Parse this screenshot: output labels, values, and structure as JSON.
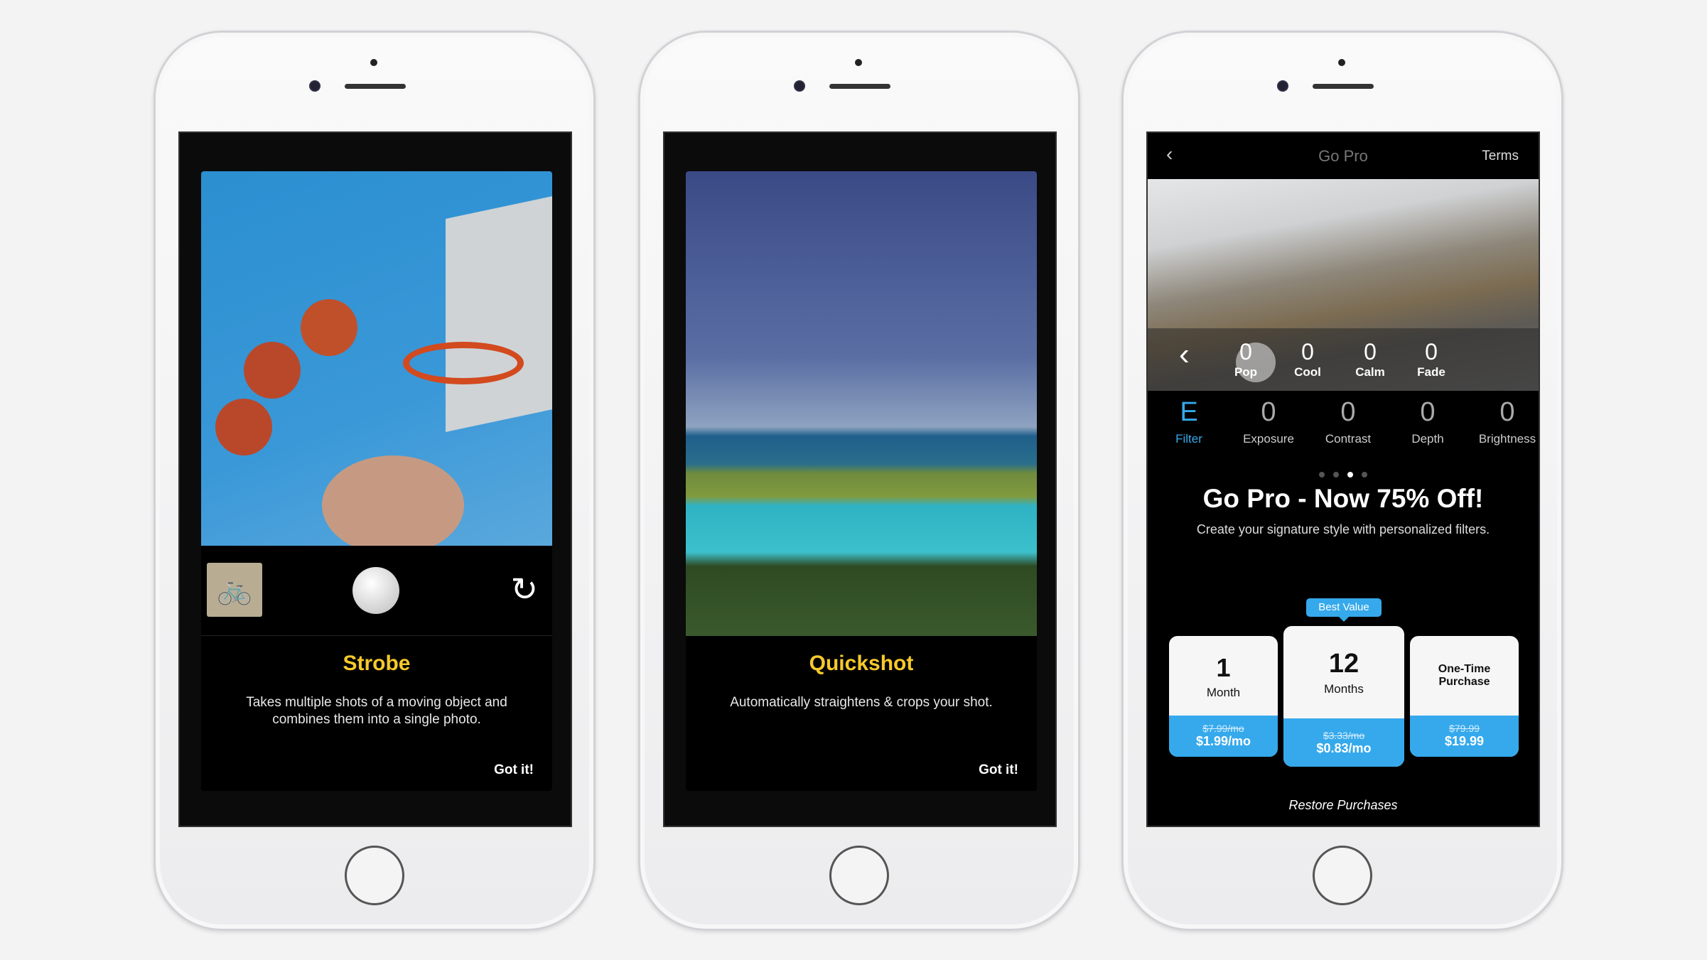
{
  "phones": [
    {
      "feature_title": "Strobe",
      "description": "Takes multiple shots of a moving object and combines them into a single photo.",
      "dismiss_label": "Got it!"
    },
    {
      "feature_title": "Quickshot",
      "description": "Automatically straightens & crops your shot.",
      "dismiss_label": "Got it!"
    }
  ],
  "gopro": {
    "header": {
      "title": "Go Pro",
      "terms_label": "Terms",
      "back_icon": "chevron-left-icon"
    },
    "filters": [
      {
        "value": "0",
        "label": "Pop"
      },
      {
        "value": "0",
        "label": "Cool"
      },
      {
        "value": "0",
        "label": "Calm"
      },
      {
        "value": "0",
        "label": "Fade"
      }
    ],
    "tools": [
      {
        "icon": "E",
        "label": "Filter",
        "active": true
      },
      {
        "icon": "0",
        "label": "Exposure"
      },
      {
        "icon": "0",
        "label": "Contrast"
      },
      {
        "icon": "0",
        "label": "Depth"
      },
      {
        "icon": "0",
        "label": "Brightness"
      }
    ],
    "page_dots": {
      "count": 4,
      "active_index": 2
    },
    "headline": "Go Pro - Now 75% Off!",
    "subheadline": "Create your signature style with personalized filters.",
    "badge": "Best Value",
    "plans": [
      {
        "number": "1",
        "unit": "Month",
        "old_price": "$7.99/mo",
        "price": "$1.99/mo"
      },
      {
        "number": "12",
        "unit": "Months",
        "old_price": "$3.33/mo",
        "price": "$0.83/mo"
      },
      {
        "name": "One-Time Purchase",
        "old_price": "$79.99",
        "price": "$19.99"
      }
    ],
    "restore_label": "Restore Purchases"
  },
  "colors": {
    "accent_blue": "#35a9ec",
    "feature_yellow": "#f5c92a",
    "background": "#f3f3f4"
  }
}
